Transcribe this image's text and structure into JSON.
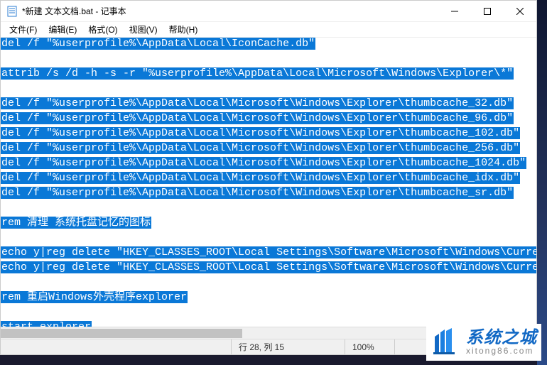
{
  "window": {
    "title": "*新建 文本文档.bat - 记事本"
  },
  "menubar": {
    "items": [
      {
        "label": "文件(F)"
      },
      {
        "label": "编辑(E)"
      },
      {
        "label": "格式(O)"
      },
      {
        "label": "视图(V)"
      },
      {
        "label": "帮助(H)"
      }
    ]
  },
  "selection_color": "#0a78d7",
  "editor": {
    "lines": [
      "del /f \"%userprofile%\\AppData\\Local\\IconCache.db\"",
      "",
      "attrib /s /d -h -s -r \"%userprofile%\\AppData\\Local\\Microsoft\\Windows\\Explorer\\*\"",
      "",
      "del /f \"%userprofile%\\AppData\\Local\\Microsoft\\Windows\\Explorer\\thumbcache_32.db\"",
      "del /f \"%userprofile%\\AppData\\Local\\Microsoft\\Windows\\Explorer\\thumbcache_96.db\"",
      "del /f \"%userprofile%\\AppData\\Local\\Microsoft\\Windows\\Explorer\\thumbcache_102.db\"",
      "del /f \"%userprofile%\\AppData\\Local\\Microsoft\\Windows\\Explorer\\thumbcache_256.db\"",
      "del /f \"%userprofile%\\AppData\\Local\\Microsoft\\Windows\\Explorer\\thumbcache_1024.db\"",
      "del /f \"%userprofile%\\AppData\\Local\\Microsoft\\Windows\\Explorer\\thumbcache_idx.db\"",
      "del /f \"%userprofile%\\AppData\\Local\\Microsoft\\Windows\\Explorer\\thumbcache_sr.db\"",
      "",
      "rem 清理 系统托盘记忆的图标",
      "",
      "echo y|reg delete \"HKEY_CLASSES_ROOT\\Local Settings\\Software\\Microsoft\\Windows\\CurrentV",
      "echo y|reg delete \"HKEY_CLASSES_ROOT\\Local Settings\\Software\\Microsoft\\Windows\\CurrentV",
      "",
      "rem 重启Windows外壳程序explorer",
      "",
      "start explorer"
    ]
  },
  "statusbar": {
    "position": "行 28, 列 15",
    "zoom": "100%"
  },
  "watermark": {
    "title": "系统之城",
    "url": "xitong86.com"
  }
}
